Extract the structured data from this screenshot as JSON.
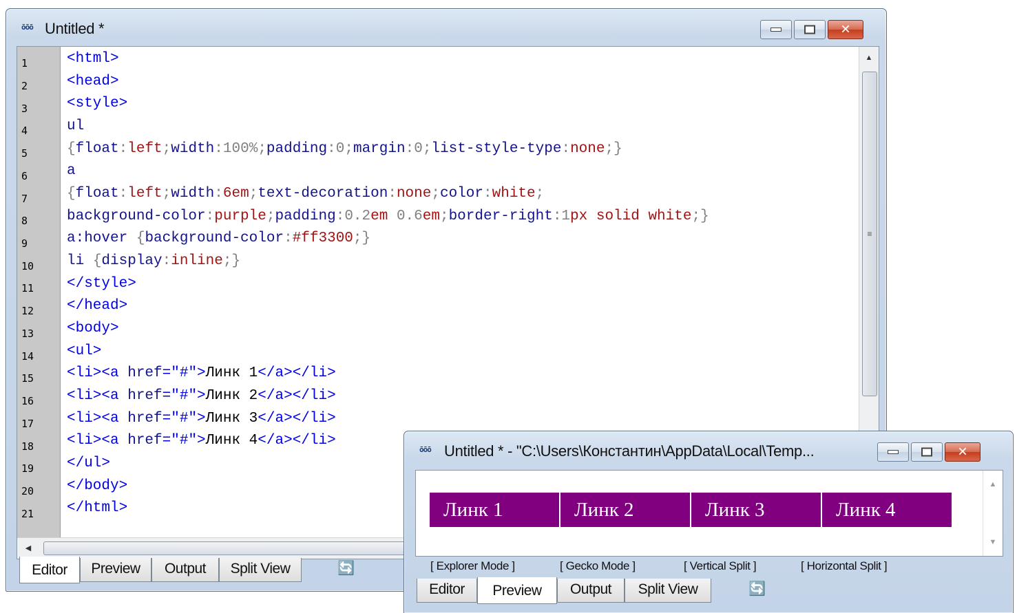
{
  "editor_window": {
    "title": "Untitled *",
    "app_icon_text": "ōōō",
    "close_glyph": "✕",
    "line_numbers": [
      "1",
      "2",
      "3",
      "4",
      "5",
      "6",
      "7",
      "8",
      "9",
      "10",
      "11",
      "12",
      "13",
      "14",
      "15",
      "16",
      "17",
      "18",
      "19",
      "20",
      "21"
    ],
    "code": {
      "l1": "<html>",
      "l2": "<head>",
      "l3": "<style>",
      "l4": "ul",
      "l5_parts": [
        "{",
        "float",
        ":",
        "left",
        ";",
        "width",
        ":",
        "100%",
        ";",
        "padding",
        ":",
        "0",
        ";",
        "margin",
        ":",
        "0",
        ";",
        "list-style-type",
        ":",
        "none",
        ";}"
      ],
      "l6": "a",
      "l7_parts": [
        "{",
        "float",
        ":",
        "left",
        ";",
        "width",
        ":",
        "6em",
        ";",
        "text-decoration",
        ":",
        "none",
        ";",
        "color",
        ":",
        "white",
        ";"
      ],
      "l8_parts": [
        "background-color",
        ":",
        "purple",
        ";",
        "padding",
        ":",
        "0.2",
        "em ",
        "0.6",
        "em",
        ";",
        "border-right",
        ":",
        "1",
        "px solid white",
        ";}"
      ],
      "l9_parts": [
        "a:hover ",
        "{",
        "background-color",
        ":",
        "#ff3300",
        ";}"
      ],
      "l10_parts": [
        "li ",
        "{",
        "display",
        ":",
        "inline",
        ";}"
      ],
      "l11": "</style>",
      "l12": "</head>",
      "l13": "<body>",
      "l14": "<ul>",
      "li_prefix": "<li><a ",
      "li_attr": "href",
      "li_eq": "=\"#\">",
      "li_suffix": "</a></li>",
      "li_texts": [
        "Линк 1",
        "Линк 2",
        "Линк 3",
        "Линк 4"
      ],
      "l19": "</ul>",
      "l20": "</body>",
      "l21": "</html>"
    },
    "tabs": [
      "Editor",
      "Preview",
      "Output",
      "Split View"
    ],
    "toolbar_icon": "🔄"
  },
  "preview_window": {
    "title": "Untitled * - \"C:\\Users\\Константин\\AppData\\Local\\Temp...",
    "app_icon_text": "ōōō",
    "close_glyph": "✕",
    "nav_links": [
      "Линк 1",
      "Линк 2",
      "Линк 3",
      "Линк 4"
    ],
    "nav_color": "#800080",
    "modes": [
      "[ Explorer Mode ]",
      "[ Gecko Mode ]",
      "[ Vertical Split ]",
      "[ Horizontal Split ]"
    ],
    "tabs": [
      "Editor",
      "Preview",
      "Output",
      "Split View"
    ],
    "toolbar_icon": "🔄"
  }
}
